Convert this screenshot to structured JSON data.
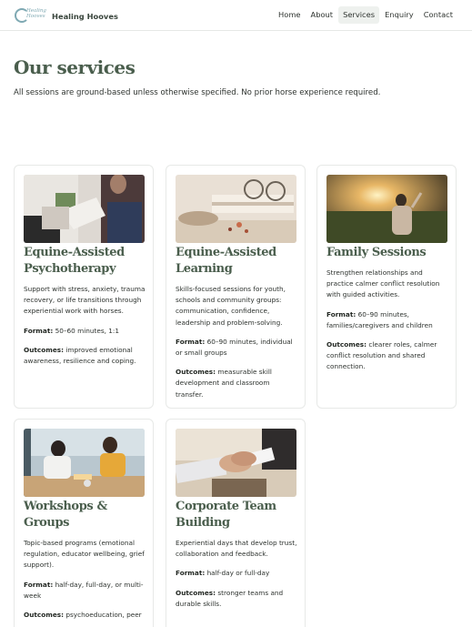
{
  "header": {
    "logo_text": "Healing Hooves",
    "brand_name": "Healing Hooves",
    "nav": [
      {
        "label": "Home",
        "active": false
      },
      {
        "label": "About",
        "active": false
      },
      {
        "label": "Services",
        "active": true
      },
      {
        "label": "Enquiry",
        "active": false
      },
      {
        "label": "Contact",
        "active": false
      }
    ]
  },
  "page": {
    "title": "Our services",
    "intro": "All sessions are ground-based unless otherwise specified. No prior horse experience required."
  },
  "cards": [
    {
      "title": "Equine-Assisted Psychotherapy",
      "image": "therapy-session-photo",
      "description": "Support with stress, anxiety, trauma recovery, or life transitions through experiential work with horses.",
      "format_label": "Format:",
      "format": "50–60 minutes, 1:1",
      "outcomes_label": "Outcomes:",
      "outcomes": "improved emotional awareness, resilience and coping."
    },
    {
      "title": "Equine-Assisted Learning",
      "image": "books-and-glasses-photo",
      "description": "Skills-focused sessions for youth, schools and community groups: communication, confidence, leadership and problem-solving.",
      "format_label": "Format:",
      "format": "60–90 minutes, individual or small groups",
      "outcomes_label": "Outcomes:",
      "outcomes": "measurable skill development and classroom transfer."
    },
    {
      "title": "Family Sessions",
      "image": "sunset-field-photo",
      "description": "Strengthen relationships and practice calmer conflict resolution with guided activities.",
      "format_label": "Format:",
      "format": "60–90 minutes, families/caregivers and children",
      "outcomes_label": "Outcomes:",
      "outcomes": "clearer roles, calmer conflict resolution and shared connection."
    },
    {
      "title": "Workshops & Groups",
      "image": "workshop-group-photo",
      "description": "Topic-based programs (emotional regulation, educator wellbeing, grief support).",
      "format_label": "Format:",
      "format": "half-day, full-day, or multi-week",
      "outcomes_label": "Outcomes:",
      "outcomes": "psychoeducation, peer"
    },
    {
      "title": "Corporate Team Building",
      "image": "handshake-photo",
      "description": "Experiential days that develop trust, collaboration and feedback.",
      "format_label": "Format:",
      "format": "half-day or full-day",
      "outcomes_label": "Outcomes:",
      "outcomes": "stronger teams and durable skills."
    }
  ]
}
